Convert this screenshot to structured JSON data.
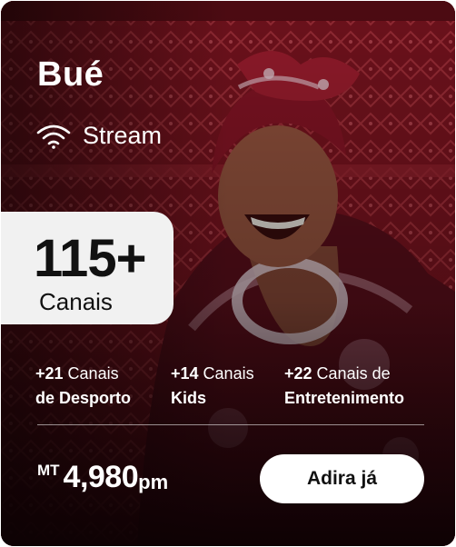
{
  "plan": {
    "name": "Bué",
    "stream_label": "Stream",
    "channels_count": "115+",
    "channels_label": "Canais"
  },
  "packages": [
    {
      "count": "+21",
      "line1_rest": " Canais",
      "line2": "de Desporto"
    },
    {
      "count": "+14",
      "line1_rest": " Canais",
      "line2": "Kids"
    },
    {
      "count": "+22",
      "line1_rest": " Canais de",
      "line2": "Entretenimento"
    }
  ],
  "price": {
    "currency": "MT",
    "amount": "4,980",
    "period": "pm"
  },
  "cta": {
    "label": "Adira já"
  },
  "icons": {
    "stream": "wifi-icon"
  },
  "colors": {
    "background_red": "#8e1722",
    "button": "#ffffff",
    "text": "#ffffff"
  }
}
